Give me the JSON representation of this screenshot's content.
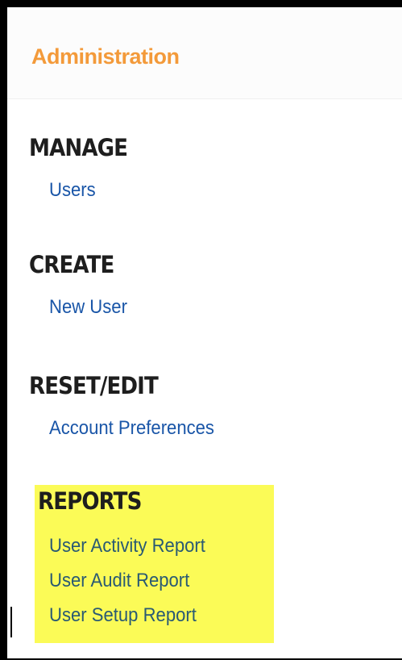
{
  "header": {
    "title": "Administration"
  },
  "sections": {
    "manage": {
      "heading": "MANAGE",
      "links": [
        "Users"
      ]
    },
    "create": {
      "heading": "CREATE",
      "links": [
        "New User"
      ]
    },
    "reset_edit": {
      "heading": "RESET/EDIT",
      "links": [
        "Account Preferences"
      ]
    },
    "reports": {
      "heading": "REPORTS",
      "links": [
        "User Activity Report",
        "User Audit Report",
        "User Setup Report"
      ],
      "highlighted": true
    }
  },
  "colors": {
    "header_title": "#f39a3a",
    "link": "#1a56a8",
    "highlight": "#fbfb57",
    "heading": "#1e1e1e"
  },
  "icons": []
}
